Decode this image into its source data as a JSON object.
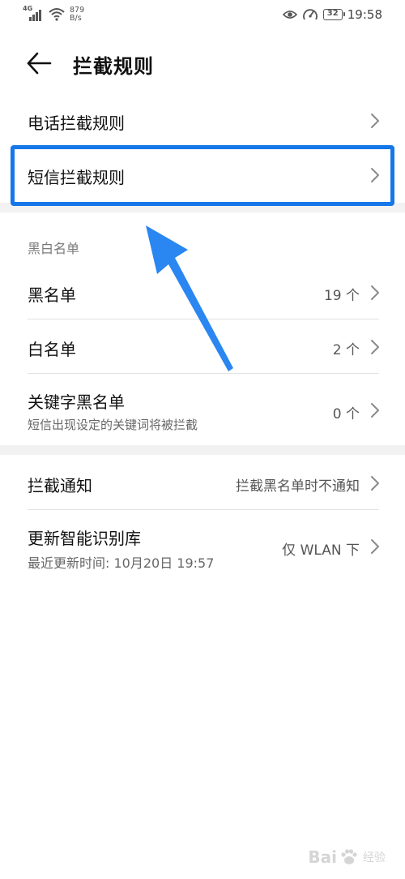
{
  "status_bar": {
    "network": "4G",
    "speed_value": "879",
    "speed_unit": "B/s",
    "battery": "32",
    "time": "19:58"
  },
  "header": {
    "title": "拦截规则"
  },
  "rules": {
    "call_rules": "电话拦截规则",
    "sms_rules": "短信拦截规则"
  },
  "lists_section": {
    "heading": "黑白名单",
    "blacklist": {
      "label": "黑名单",
      "value": "19 个"
    },
    "whitelist": {
      "label": "白名单",
      "value": "2 个"
    },
    "keyword_blacklist": {
      "label": "关键字黑名单",
      "sub": "短信出现设定的关键词将被拦截",
      "value": "0 个"
    }
  },
  "notify_section": {
    "notify": {
      "label": "拦截通知",
      "value": "拦截黑名单时不通知"
    },
    "update": {
      "label": "更新智能识别库",
      "sub": "最近更新时间: 10月20日 19:57",
      "value": "仅 WLAN 下"
    }
  },
  "watermark": {
    "brand": "Bai",
    "sub": "经验"
  },
  "colors": {
    "accent": "#1677e8",
    "divider": "#e2e2e2",
    "band": "#f2f2f2"
  }
}
